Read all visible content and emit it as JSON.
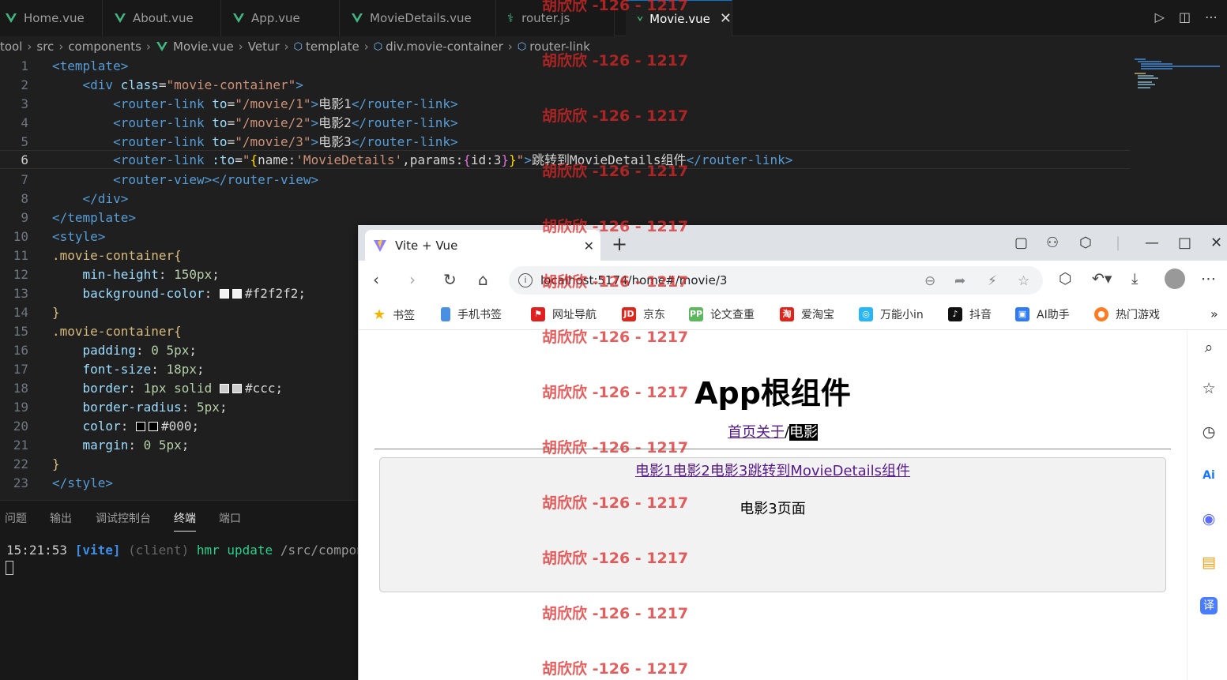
{
  "editor": {
    "tabs": [
      {
        "label": "Home.vue"
      },
      {
        "label": "About.vue"
      },
      {
        "label": "App.vue"
      },
      {
        "label": "MovieDetails.vue"
      },
      {
        "label": "router.js"
      },
      {
        "label": "Movie.vue"
      }
    ],
    "breadcrumb": [
      "tool",
      "src",
      "components",
      "Movie.vue",
      "Vetur",
      "template",
      "div.movie-container",
      "router-link"
    ],
    "line_numbers": [
      "1",
      "2",
      "3",
      "4",
      "5",
      "6",
      "7",
      "8",
      "9",
      "10",
      "11",
      "12",
      "13",
      "14",
      "15",
      "16",
      "17",
      "18",
      "19",
      "20",
      "21",
      "22",
      "23"
    ],
    "code": {
      "l1_tag": "<template>",
      "l2_open": "<div",
      "l2_attr": "class",
      "l2_val": "\"movie-container\"",
      "l2_close": ">",
      "l3_open": "<router-link",
      "l3_attr": "to",
      "l3_val": "\"/movie/1\"",
      "l3_text": "电影1",
      "l3_close": "</router-link>",
      "l4_open": "<router-link",
      "l4_attr": "to",
      "l4_val": "\"/movie/2\"",
      "l4_text": "电影2",
      "l4_close": "</router-link>",
      "l5_open": "<router-link",
      "l5_attr": "to",
      "l5_val": "\"/movie/3\"",
      "l5_text": "电影3",
      "l5_close": "</router-link>",
      "l6_open": "<router-link",
      "l6_attr": ":to",
      "l6_q1": "\"",
      "l6_b1": "{",
      "l6_k1": "name",
      "l6_v1": "'MovieDetails'",
      "l6_k2": ",params:",
      "l6_b2": "{",
      "l6_k3": "id:3",
      "l6_b3": "}",
      "l6_b4": "}",
      "l6_q2": "\"",
      "l6_text": "跳转到MovieDetails组件",
      "l6_close": "</router-link>",
      "l7_tag": "<router-view></router-view>",
      "l8_tag": "</div>",
      "l9_tag": "</template>",
      "l10_tag": "<style>",
      "l11_sel": ".movie-container{",
      "l12_prop": "min-height",
      "l12_val": "150px",
      "l13_prop": "background-color",
      "l13_val": "#f2f2f2",
      "l14": "}",
      "l15_sel": ".movie-container{",
      "l16_prop": "padding",
      "l16_val": "0 5px",
      "l17_prop": "font-size",
      "l17_val": "18px",
      "l18_prop": "border",
      "l18_val1": "1px solid",
      "l18_val2": "#ccc",
      "l19_prop": "border-radius",
      "l19_val": "5px",
      "l20_prop": "color",
      "l20_val": "#000",
      "l21_prop": "margin",
      "l21_val": "0 5px",
      "l22": "}",
      "l23_tag": "</style>"
    },
    "panel_tabs": [
      "问题",
      "输出",
      "调试控制台",
      "终端",
      "端口"
    ],
    "terminal": {
      "time": "15:21:53",
      "tag": "[vite]",
      "client": "(client)",
      "action": "hmr update",
      "path": "/src/components/Movie.vue"
    }
  },
  "browser": {
    "tab_title": "Vite + Vue",
    "url": "localhost:5174/home#/movie/3",
    "bookmarks": [
      "书签",
      "手机书签",
      "网址导航",
      "京东",
      "论文查重",
      "爱淘宝",
      "万能小in",
      "抖音",
      "AI助手",
      "热门游戏"
    ],
    "page": {
      "title": "App根组件",
      "nav_home": "首页",
      "nav_about": "关于",
      "nav_sep": "/",
      "nav_movie": "电影",
      "movie_links": "电影1电影2电影3跳转到MovieDetails组件",
      "movie_page": "电影3页面"
    }
  },
  "watermark": "胡欣欣 -126 - 1217",
  "colors": {
    "vue_green": "#41b883",
    "vscode_bg": "#1f1f1f",
    "link_visited": "#551a8b",
    "watermark_red": "#dc2828"
  }
}
